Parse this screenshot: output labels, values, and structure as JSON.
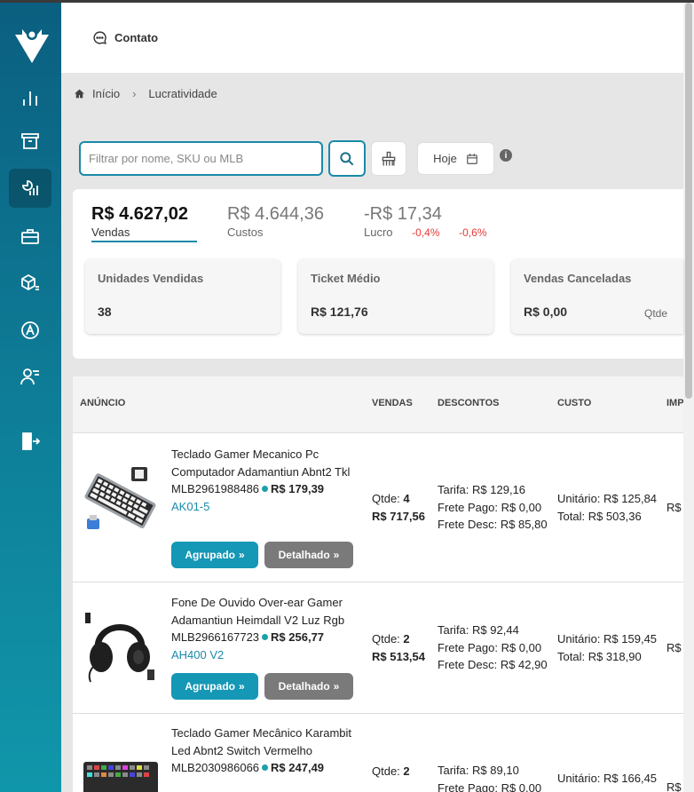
{
  "header": {
    "contato_label": "Contato"
  },
  "breadcrumb": {
    "home": "Início",
    "current": "Lucratividade"
  },
  "filters": {
    "search_placeholder": "Filtrar por nome, SKU ou MLB",
    "date_label": "Hoje"
  },
  "summary": {
    "vendas": {
      "value": "R$ 4.627,02",
      "label": "Vendas"
    },
    "custos": {
      "value": "R$ 4.644,36",
      "label": "Custos"
    },
    "lucro": {
      "value": "-R$ 17,34",
      "label": "Lucro",
      "pct1": "-0,4%",
      "pct2": "-0,6%"
    }
  },
  "cards": [
    {
      "title": "Unidades Vendidas",
      "value": "38"
    },
    {
      "title": "Ticket Médio",
      "value": "R$ 121,76"
    },
    {
      "title": "Vendas Canceladas",
      "value": "R$ 0,00",
      "extra": "Qtde"
    }
  ],
  "table": {
    "headers": {
      "anuncio": "ANÚNCIO",
      "vendas": "VENDAS",
      "descontos": "DESCONTOS",
      "custo": "CUSTO",
      "imp": "IMP"
    },
    "rows": [
      {
        "title": "Teclado Gamer Mecanico Pc Computador Adamantiun Abnt2 Tkl",
        "mlb": "MLB2961988486",
        "price": "R$ 179,39",
        "sku": "AK01-5",
        "qtde": "4",
        "total_vendas": "R$ 717,56",
        "tarifa": "R$ 129,16",
        "frete_pago": "R$ 0,00",
        "frete_desc": "R$ 85,80",
        "unitario": "R$ 125,84",
        "total_custo": "R$ 503,36",
        "imp": "R$"
      },
      {
        "title": "Fone De Ouvido Over-ear Gamer Adamantiun Heimdall V2 Luz Rgb",
        "mlb": "MLB2966167723",
        "price": "R$ 256,77",
        "sku": "AH400 V2",
        "qtde": "2",
        "total_vendas": "R$ 513,54",
        "tarifa": "R$ 92,44",
        "frete_pago": "R$ 0,00",
        "frete_desc": "R$ 42,90",
        "unitario": "R$ 159,45",
        "total_custo": "R$ 318,90",
        "imp": "R$"
      },
      {
        "title": "Teclado Gamer Mecânico Karambit Led Abnt2 Switch Vermelho",
        "mlb": "MLB2030986066",
        "price": "R$ 247,49",
        "qtde": "2",
        "tarifa": "R$ 89,10",
        "frete_pago": "R$ 0,00",
        "unitario": "R$ 166,45",
        "imp": "R$"
      }
    ]
  },
  "labels": {
    "qtde": "Qtde:",
    "tarifa": "Tarifa:",
    "frete_pago": "Frete Pago:",
    "frete_desc": "Frete Desc:",
    "unitario": "Unitário:",
    "total": "Total:",
    "agrupado": "Agrupado",
    "detalhado": "Detalhado"
  },
  "colors": {
    "accent": "#1a8aa8",
    "sidebar_top": "#0b5f80",
    "sidebar_bottom": "#1096aa",
    "negative": "#e53935",
    "secondary_button": "#7a7a7a"
  }
}
